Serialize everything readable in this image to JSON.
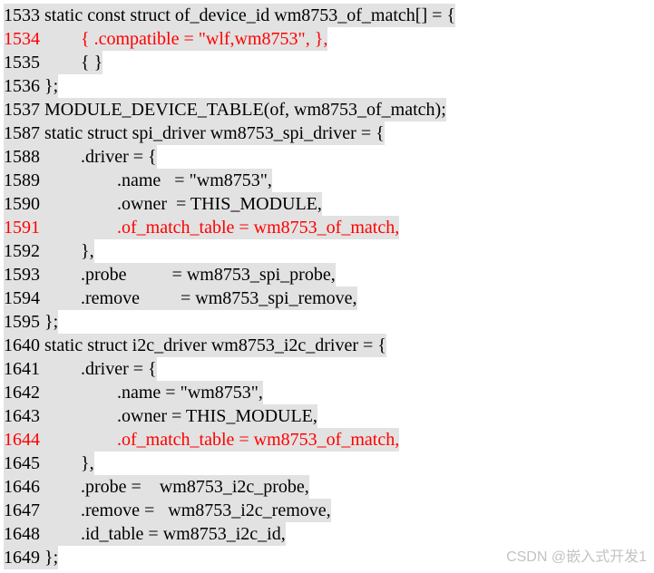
{
  "lines": [
    {
      "num": "1533",
      "code": " static const struct of_device_id wm8753_of_match[] = {",
      "red": false
    },
    {
      "num": "1534",
      "code": "         { .compatible = \"wlf,wm8753\", },",
      "red": true
    },
    {
      "num": "1535",
      "code": "         { }",
      "red": false
    },
    {
      "num": "1536",
      "code": " };",
      "red": false
    },
    {
      "num": "1537",
      "code": " MODULE_DEVICE_TABLE(of, wm8753_of_match);",
      "red": false
    },
    {
      "num": "1587",
      "code": " static struct spi_driver wm8753_spi_driver = {",
      "red": false
    },
    {
      "num": "1588",
      "code": "         .driver = {",
      "red": false
    },
    {
      "num": "1589",
      "code": "                 .name   = \"wm8753\",",
      "red": false
    },
    {
      "num": "1590",
      "code": "                 .owner  = THIS_MODULE,",
      "red": false
    },
    {
      "num": "1591",
      "code": "                 .of_match_table = wm8753_of_match,",
      "red": true
    },
    {
      "num": "1592",
      "code": "         },",
      "red": false
    },
    {
      "num": "1593",
      "code": "         .probe          = wm8753_spi_probe,",
      "red": false
    },
    {
      "num": "1594",
      "code": "         .remove         = wm8753_spi_remove,",
      "red": false
    },
    {
      "num": "1595",
      "code": " };",
      "red": false
    },
    {
      "num": "1640",
      "code": " static struct i2c_driver wm8753_i2c_driver = {",
      "red": false
    },
    {
      "num": "1641",
      "code": "         .driver = {",
      "red": false
    },
    {
      "num": "1642",
      "code": "                 .name = \"wm8753\",",
      "red": false
    },
    {
      "num": "1643",
      "code": "                 .owner = THIS_MODULE,",
      "red": false
    },
    {
      "num": "1644",
      "code": "                 .of_match_table = wm8753_of_match,",
      "red": true
    },
    {
      "num": "1645",
      "code": "         },",
      "red": false
    },
    {
      "num": "1646",
      "code": "         .probe =    wm8753_i2c_probe,",
      "red": false
    },
    {
      "num": "1647",
      "code": "         .remove =   wm8753_i2c_remove,",
      "red": false
    },
    {
      "num": "1648",
      "code": "         .id_table = wm8753_i2c_id,",
      "red": false
    },
    {
      "num": "1649",
      "code": " };",
      "red": false
    }
  ],
  "watermark": "CSDN @嵌入式开发1"
}
